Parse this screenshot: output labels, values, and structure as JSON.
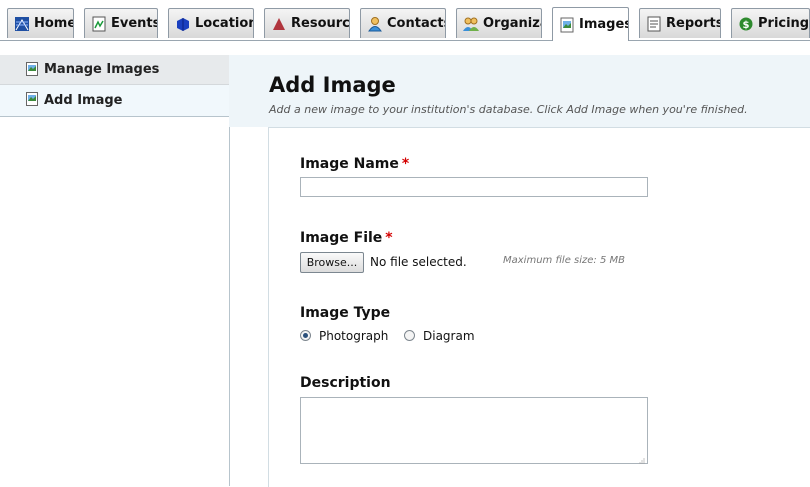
{
  "tabs": [
    {
      "label": "Home",
      "icon": "home-icon"
    },
    {
      "label": "Events",
      "icon": "events-icon"
    },
    {
      "label": "Locations",
      "icon": "locations-icon"
    },
    {
      "label": "Resources",
      "icon": "resources-icon"
    },
    {
      "label": "Contacts",
      "icon": "contacts-icon"
    },
    {
      "label": "Organizat",
      "icon": "organizations-icon"
    },
    {
      "label": "Images",
      "icon": "images-icon",
      "active": true
    },
    {
      "label": "Reports",
      "icon": "reports-icon"
    },
    {
      "label": "Pricing",
      "icon": "pricing-icon"
    }
  ],
  "sidebar": {
    "items": [
      {
        "label": "Manage Images",
        "icon": "image-page-icon"
      },
      {
        "label": "Add Image",
        "icon": "image-page-icon",
        "selected": true
      }
    ]
  },
  "page": {
    "title": "Add Image",
    "subtitle": "Add a new image to your institution's database. Click Add Image when you're finished."
  },
  "form": {
    "image_name": {
      "label": "Image Name",
      "required_mark": "*",
      "value": ""
    },
    "image_file": {
      "label": "Image File",
      "required_mark": "*",
      "browse_label": "Browse...",
      "status": "No file selected.",
      "max_size_note": "Maximum file size: 5 MB"
    },
    "image_type": {
      "label": "Image Type",
      "options": [
        "Photograph",
        "Diagram"
      ],
      "selected": "Photograph"
    },
    "description": {
      "label": "Description",
      "value": ""
    }
  },
  "colors": {
    "accent_blue": "#eef5f9",
    "required_red": "#d40000",
    "selected_bg": "#f1f8fc"
  }
}
